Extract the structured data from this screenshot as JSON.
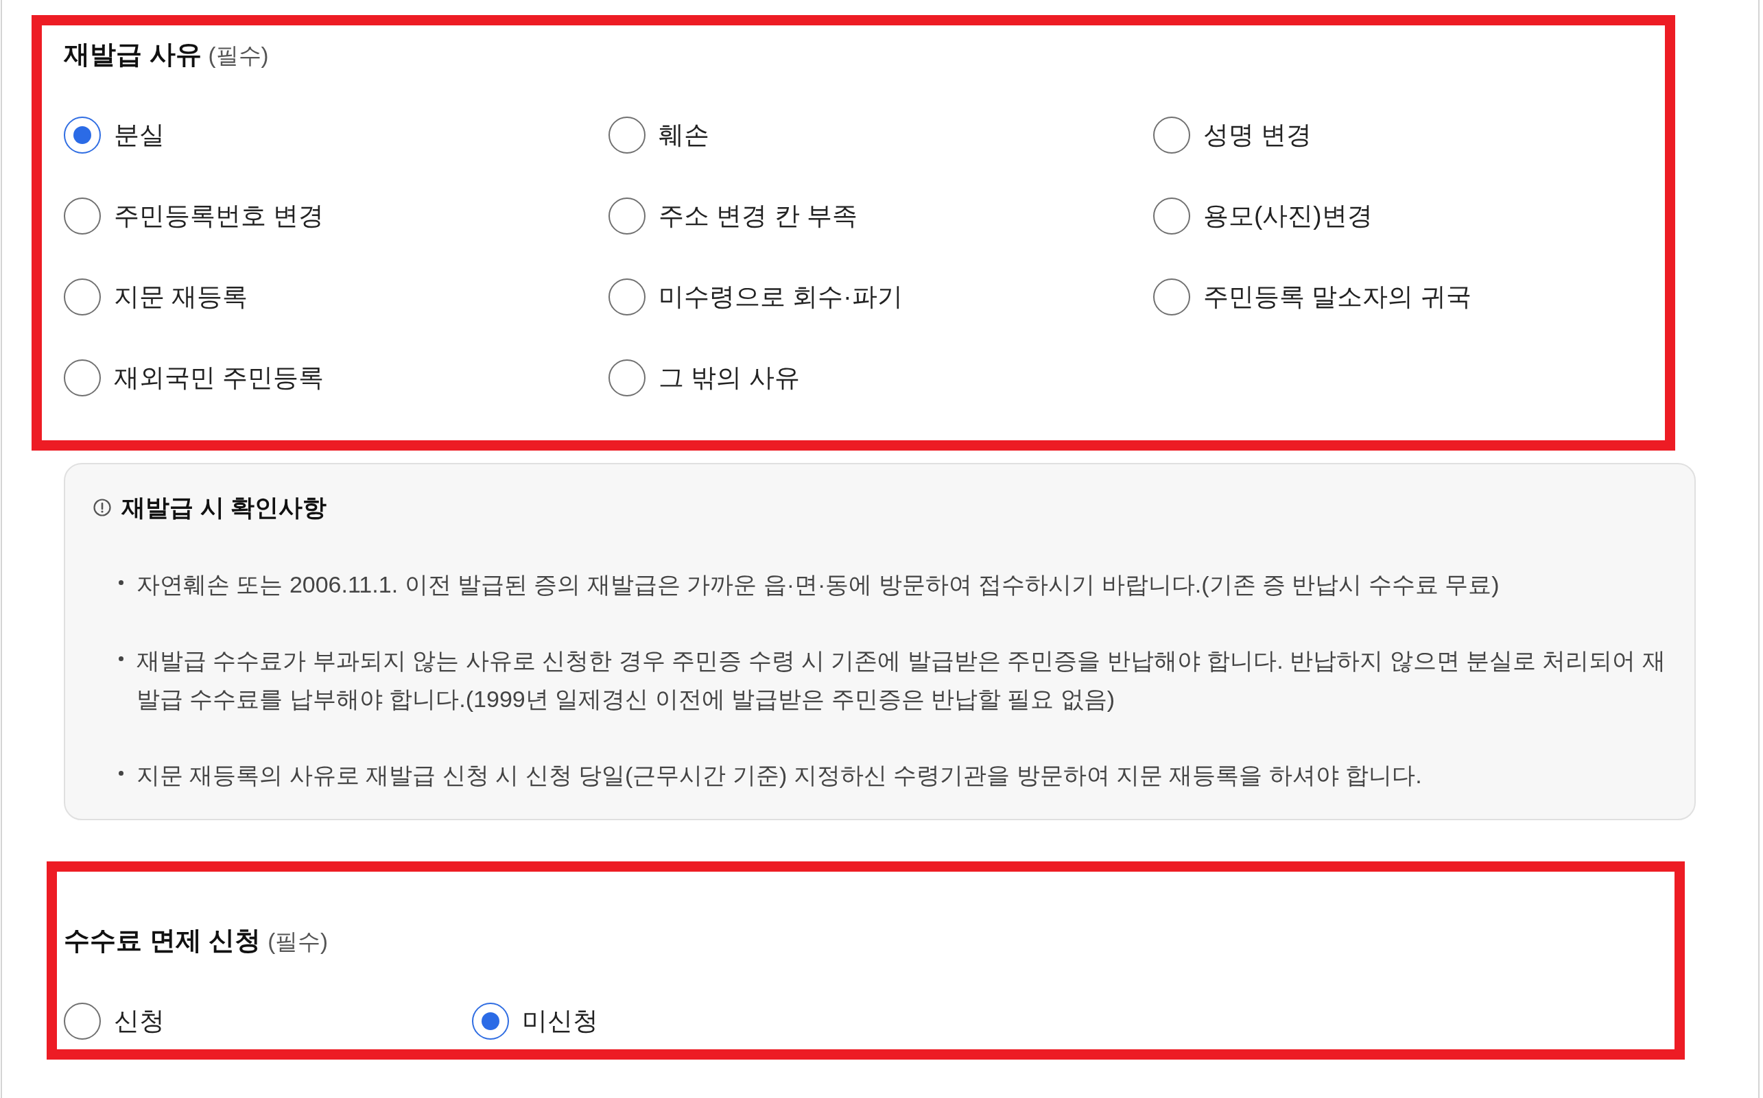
{
  "reissue_reason": {
    "highlighted": true,
    "title": "재발급 사유",
    "required_note": "(필수)",
    "options": [
      {
        "label": "분실",
        "selected": true
      },
      {
        "label": "훼손",
        "selected": false
      },
      {
        "label": "성명 변경",
        "selected": false
      },
      {
        "label": "주민등록번호 변경",
        "selected": false
      },
      {
        "label": "주소 변경 칸 부족",
        "selected": false
      },
      {
        "label": "용모(사진)변경",
        "selected": false
      },
      {
        "label": "지문 재등록",
        "selected": false
      },
      {
        "label": "미수령으로 회수·파기",
        "selected": false
      },
      {
        "label": "주민등록 말소자의 귀국",
        "selected": false
      },
      {
        "label": "재외국민 주민등록",
        "selected": false
      },
      {
        "label": "그 밖의 사유",
        "selected": false
      }
    ]
  },
  "notice": {
    "title": "재발급 시 확인사항",
    "items": [
      "자연훼손 또는 2006.11.1. 이전 발급된 증의 재발급은 가까운 읍·면·동에 방문하여 접수하시기 바랍니다.(기존 증 반납시 수수료 무료)",
      "재발급 수수료가 부과되지 않는 사유로 신청한 경우 주민증 수령 시 기존에 발급받은 주민증을 반납해야 합니다. 반납하지 않으면 분실로 처리되어 재발급 수수료를 납부해야 합니다.(1999년 일제경신 이전에 발급받은 주민증은 반납할 필요 없음)",
      "지문 재등록의 사유로 재발급 신청 시 신청 당일(근무시간 기준) 지정하신 수령기관을 방문하여 지문 재등록을 하셔야 합니다."
    ]
  },
  "fee_exemption": {
    "highlighted": true,
    "title": "수수료 면제 신청",
    "required_note": "(필수)",
    "options": [
      {
        "label": "신청",
        "selected": false
      },
      {
        "label": "미신청",
        "selected": true
      }
    ]
  }
}
